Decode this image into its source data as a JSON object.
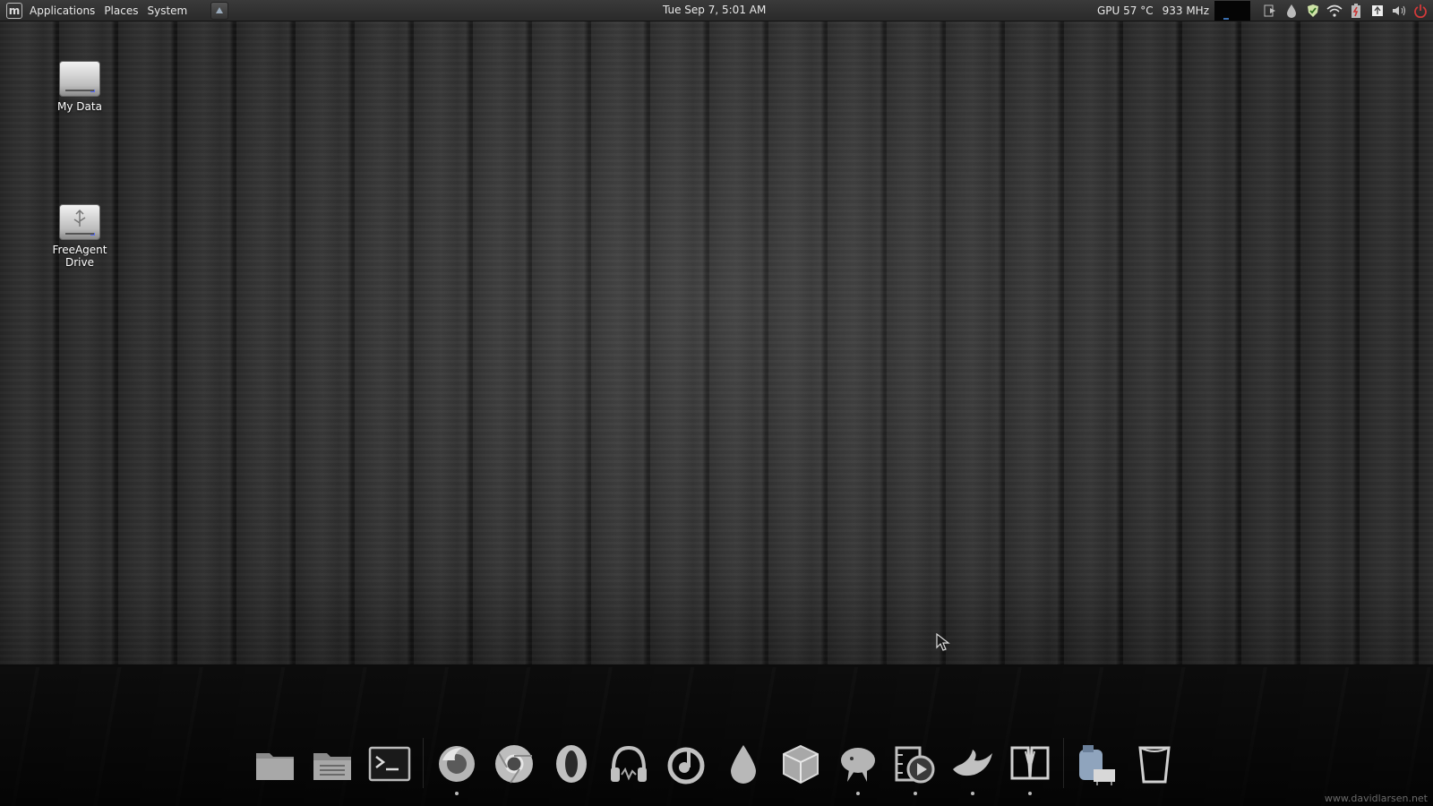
{
  "panel": {
    "logo_letter": "m",
    "menus": [
      "Applications",
      "Places",
      "System"
    ],
    "clock": "Tue Sep  7,  5:01 AM",
    "gpu": "GPU 57 °C",
    "cpu_freq": "933 MHz"
  },
  "tray_icons": [
    "media-player-icon",
    "drop-icon",
    "shield-icon",
    "wifi-icon",
    "battery-icon",
    "update-icon",
    "volume-icon",
    "power-icon"
  ],
  "desktop": {
    "icons": [
      {
        "label": "My Data",
        "icon": "hard-drive-icon"
      },
      {
        "label": "FreeAgent Drive",
        "icon": "usb-drive-icon"
      }
    ]
  },
  "dock": {
    "items": [
      {
        "icon": "folder-icon",
        "running": false
      },
      {
        "icon": "file-manager-icon",
        "running": false
      },
      {
        "icon": "terminal-icon",
        "running": false
      },
      {
        "icon": "firefox-icon",
        "running": true
      },
      {
        "icon": "chrome-icon",
        "running": false
      },
      {
        "icon": "opera-icon",
        "running": false
      },
      {
        "icon": "headphones-icon",
        "running": false
      },
      {
        "icon": "music-player-icon",
        "running": false
      },
      {
        "icon": "drop-icon",
        "running": false
      },
      {
        "icon": "package-box-icon",
        "running": false
      },
      {
        "icon": "pidgin-icon",
        "running": true
      },
      {
        "icon": "video-player-icon",
        "running": true
      },
      {
        "icon": "gimp-icon",
        "running": true
      },
      {
        "icon": "book-icon",
        "running": true
      },
      {
        "icon": "printer-icon",
        "running": false
      },
      {
        "icon": "trash-icon",
        "running": false
      }
    ]
  },
  "watermark": "www.davidlarsen.net",
  "colors": {
    "panel": "#2f2f2f",
    "wood": "#2b2b2b",
    "accent_red": "#d23a3a"
  }
}
